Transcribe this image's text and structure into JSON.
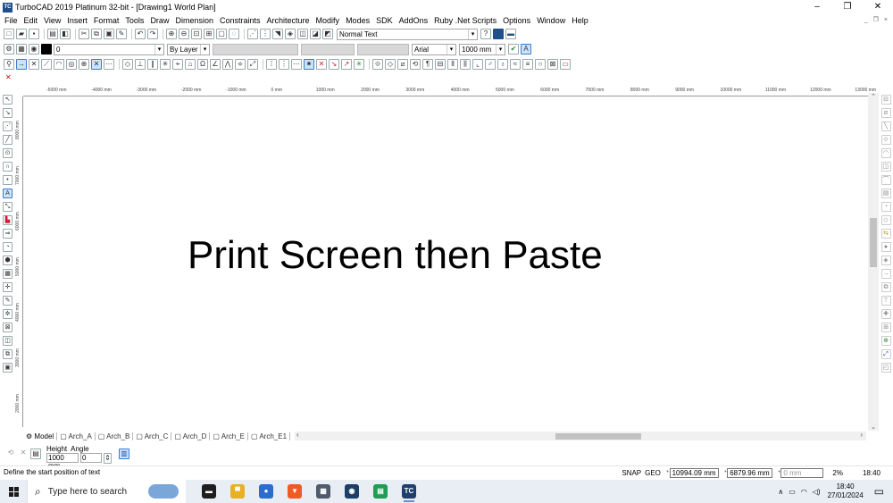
{
  "window": {
    "app_icon": "TC",
    "title": "TurboCAD 2019 Platinum 32-bit - [Drawing1 World Plan]",
    "controls": [
      "minimize-icon",
      "restore-icon",
      "close-icon"
    ]
  },
  "menu": [
    "File",
    "Edit",
    "View",
    "Insert",
    "Format",
    "Tools",
    "Draw",
    "Dimension",
    "Constraints",
    "Architecture",
    "Modify",
    "Modes",
    "SDK",
    "AddOns",
    "Ruby .Net Scripts",
    "Options",
    "Window",
    "Help"
  ],
  "toolbar1": {
    "text_style": "Normal Text"
  },
  "toolbar2": {
    "layer_value": "0",
    "color_value": "By Layer",
    "font_value": "Arial",
    "text_height_value": "1000 mm"
  },
  "ruler": {
    "h_ticks": [
      "-5000 mm",
      "-4000 mm",
      "-3000 mm",
      "-2000 mm",
      "-1000 mm",
      "0 mm",
      "1000 mm",
      "2000 mm",
      "3000 mm",
      "4000 mm",
      "5000 mm",
      "6000 mm",
      "7000 mm",
      "8000 mm",
      "9000 mm",
      "10000 mm",
      "11000 mm",
      "12000 mm",
      "13000 mm"
    ],
    "v_ticks": [
      "8000 mm",
      "7000 mm",
      "6000 mm",
      "5000 mm",
      "4000 mm",
      "3000 mm",
      "2000 mm"
    ]
  },
  "canvas": {
    "text": "Print Screen then Paste"
  },
  "tabs": [
    "Model",
    "Arch_A",
    "Arch_B",
    "Arch_C",
    "Arch_D",
    "Arch_E",
    "Arch_E1"
  ],
  "inspector": {
    "height_label": "Height",
    "angle_label": "Angle",
    "height_value": "1000 mm",
    "angle_value": "0"
  },
  "status": {
    "prompt": "Define the start position of text",
    "snap": "SNAP",
    "geo": "GEO",
    "x_coord": "10994.09 mm",
    "y_coord": "6879.96 mm",
    "z_coord": "0 mm",
    "zoom": "2%",
    "time": "18:40"
  },
  "taskbar": {
    "search_placeholder": "Type here to search",
    "clock_time": "18:40",
    "clock_date": "27/01/2024",
    "apps": [
      {
        "name": "terminal-app-icon",
        "glyph": "▬",
        "color": "#1e1e1e"
      },
      {
        "name": "file-explorer-app-icon",
        "glyph": "▀",
        "color": "#e8b025"
      },
      {
        "name": "thunderbird-app-icon",
        "glyph": "●",
        "color": "#2a6dcc"
      },
      {
        "name": "brave-app-icon",
        "glyph": "▼",
        "color": "#f05a23"
      },
      {
        "name": "calculator-app-icon",
        "glyph": "▦",
        "color": "#4f5b6a"
      },
      {
        "name": "steam-app-icon",
        "glyph": "◉",
        "color": "#1b3f66"
      },
      {
        "name": "spreadsheet-app-icon",
        "glyph": "▤",
        "color": "#1f9d55"
      },
      {
        "name": "turbocad-app-icon",
        "glyph": "TC",
        "color": "#1f3f6e"
      }
    ]
  }
}
